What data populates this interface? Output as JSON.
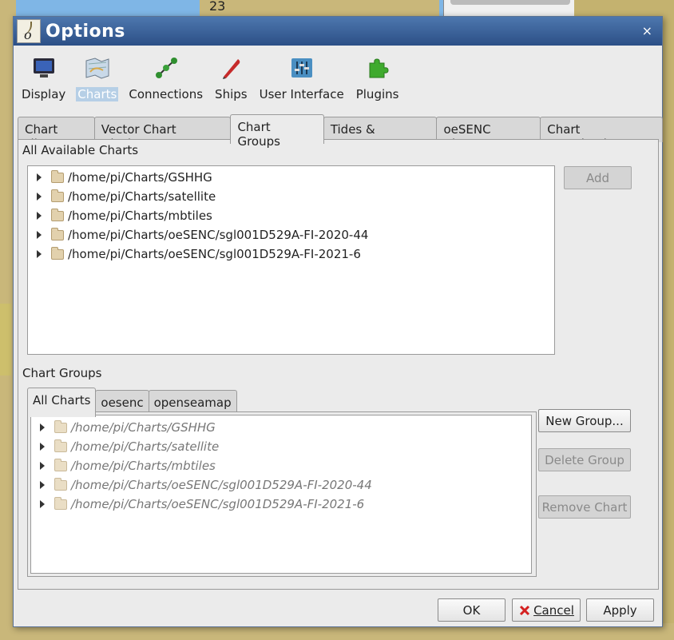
{
  "window": {
    "title": "Options",
    "close_glyph": "×",
    "app_icon_letter": "o"
  },
  "categories": [
    {
      "label": "Display",
      "icon": "monitor-icon"
    },
    {
      "label": "Charts",
      "icon": "charts-icon",
      "selected": true
    },
    {
      "label": "Connections",
      "icon": "connections-icon"
    },
    {
      "label": "Ships",
      "icon": "ship-icon"
    },
    {
      "label": "User Interface",
      "icon": "sliders-icon"
    },
    {
      "label": "Plugins",
      "icon": "puzzle-icon"
    }
  ],
  "tabs": [
    "Chart Files",
    "Vector Chart Display",
    "Chart Groups",
    "Tides & Currents",
    "oeSENC Charts",
    "Chart Downloader"
  ],
  "active_tab": "Chart Groups",
  "available": {
    "label": "All Available Charts",
    "items": [
      "/home/pi/Charts/GSHHG",
      "/home/pi/Charts/satellite",
      "/home/pi/Charts/mbtiles",
      "/home/pi/Charts/oeSENC/sgl001D529A-FI-2020-44",
      "/home/pi/Charts/oeSENC/sgl001D529A-FI-2021-6"
    ],
    "add_label": "Add"
  },
  "groups": {
    "label": "Chart Groups",
    "tabs": [
      "All Charts",
      "oesenc",
      "openseamap"
    ],
    "active_tab": "All Charts",
    "items": [
      "/home/pi/Charts/GSHHG",
      "/home/pi/Charts/satellite",
      "/home/pi/Charts/mbtiles",
      "/home/pi/Charts/oeSENC/sgl001D529A-FI-2020-44",
      "/home/pi/Charts/oeSENC/sgl001D529A-FI-2021-6"
    ],
    "new_group_label": "New Group...",
    "delete_group_label": "Delete Group",
    "remove_chart_label": "Remove Chart"
  },
  "footer": {
    "ok_label": "OK",
    "cancel_label": "Cancel",
    "apply_label": "Apply"
  },
  "background": {
    "map_number": "23"
  },
  "colors": {
    "title_bar": "#2c4f86",
    "selected_category": "#b6cfe6",
    "cancel_icon": "#d42020"
  }
}
